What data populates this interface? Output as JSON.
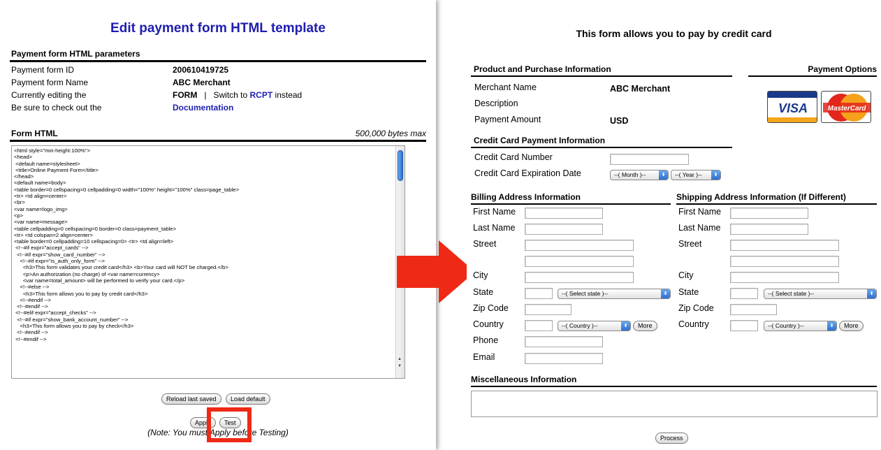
{
  "left": {
    "heading": "Edit payment form HTML template",
    "params_title": "Payment form HTML parameters",
    "rows": {
      "form_id_label": "Payment form ID",
      "form_id_value": "200610419725",
      "form_name_label": "Payment form Name",
      "form_name_value": "ABC Merchant",
      "editing_label": "Currently editing the",
      "editing_value": "FORM",
      "editing_sep": "|",
      "switch_prefix": "Switch to",
      "switch_link": "RCPT",
      "switch_suffix": "instead",
      "checkout_label": "Be sure to check out the",
      "checkout_link": "Documentation"
    },
    "form_html_title": "Form HTML",
    "bytes_max": "500,000 bytes max",
    "code": "<html style=\"min-height:100%\">\n<head>\n <default name=stylesheet>\n <title>Online Payment Form</title>\n</head>\n<default name=body>\n<table border=0 cellspacing=0 cellpadding=0 width=\"100%\" height=\"100%\" class=page_table>\n<tr> <td align=center>\n<br>\n<var name=logo_img>\n<p>\n<var name=message>\n<table cellpadding=0 cellspacing=0 border=0 class=payment_table>\n<tr> <td colspan=2 align=center>\n<table border=0 cellpadding=10 cellspacing=0> <tr> <td align=left>\n <!--#if expr=\"accept_cards\" -->\n  <!--#if expr=\"show_card_number\" -->\n    <!--#if expr=\"is_auth_only_form\" -->\n      <h3>This form validates your credit card</h3> <b>Your card will NOT be charged.</b>\n      <p>An authorization (no charge) of <var name=currency>\n      <var name=total_amount> will be performed to verify your card.</p>\n    <!--#else -->\n      <h3>This form allows you to pay by credit card</h3>\n    <!--#endif -->\n  <!--#endif -->\n <!--#elif expr=\"accept_checks\" -->\n  <!--#if expr=\"show_bank_account_number\" -->\n    <h3>This form allows you to pay by check</h3>\n  <!--#endif -->\n <!--#endif -->",
    "buttons": {
      "reload": "Reload last saved",
      "load_default": "Load default",
      "apply": "Apply",
      "test": "Test"
    },
    "note": "(Note: You must Apply before Testing)"
  },
  "right": {
    "title": "This form allows you to pay by credit card",
    "product_header": "Product and Purchase Information",
    "payment_options_header": "Payment Options",
    "merchant_label": "Merchant Name",
    "merchant_value": "ABC Merchant",
    "description_label": "Description",
    "amount_label": "Payment Amount",
    "amount_value": "USD",
    "cards": [
      "VISA",
      "MasterCard"
    ],
    "cc_header": "Credit Card Payment Information",
    "cc_number_label": "Credit Card Number",
    "cc_exp_label": "Credit Card Expiration Date",
    "month_select": "--( Month )--",
    "year_select": "--( Year )--",
    "billing_header": "Billing Address Information",
    "shipping_header": "Shipping Address Information (If Different)",
    "fields": {
      "first_name": "First Name",
      "last_name": "Last Name",
      "street": "Street",
      "city": "City",
      "state": "State",
      "zip": "Zip Code",
      "country": "Country",
      "phone": "Phone",
      "email": "Email"
    },
    "state_select": "--( Select state )--",
    "country_select": "--( Country )--",
    "more_button": "More",
    "misc_header": "Miscellaneous Information",
    "process_button": "Process"
  },
  "colors": {
    "heading_blue": "#1e1eb0",
    "arrow_red": "#ee2a16",
    "highlight_red": "#ee2a16"
  }
}
